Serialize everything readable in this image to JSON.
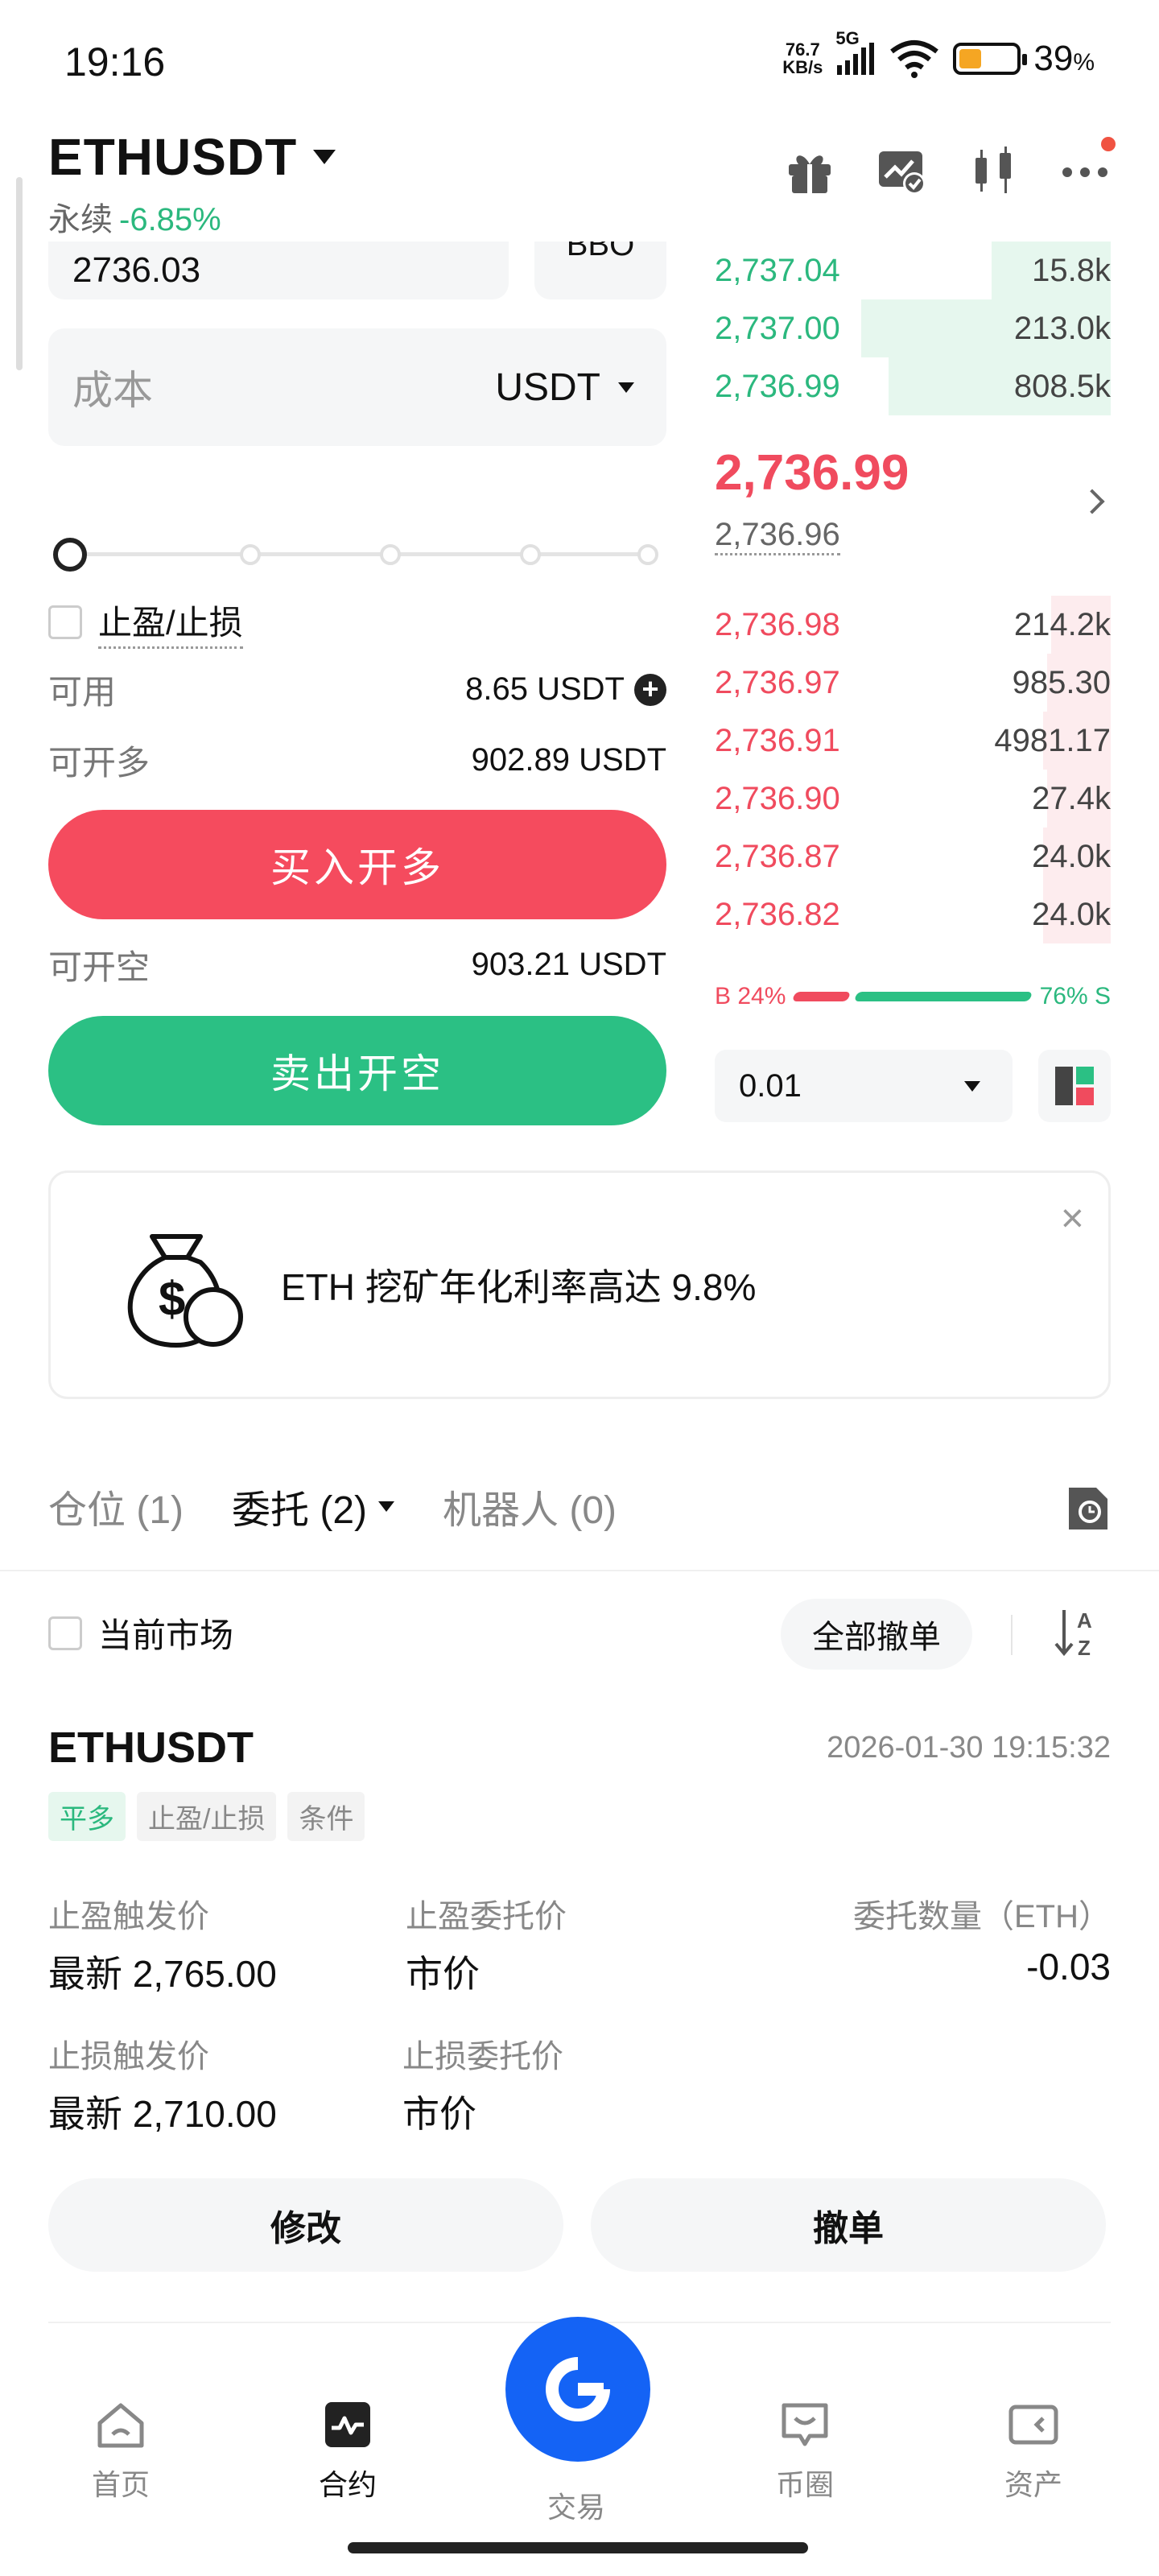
{
  "status_bar": {
    "time": "19:16",
    "net_speed_value": "76.7",
    "net_speed_unit": "KB/s",
    "network": "5G",
    "battery": "39",
    "battery_unit": "%"
  },
  "header": {
    "symbol": "ETHUSDT",
    "contract_type": "永续",
    "change": "-6.85%",
    "icons": [
      "gift-icon",
      "chart-check-icon",
      "candlestick-icon",
      "more-icon"
    ]
  },
  "order_form": {
    "price_value": "2736.03",
    "bbo_label": "BBO",
    "cost_placeholder": "成本",
    "cost_unit": "USDT",
    "slider_level": 0,
    "tpsl_label": "止盈/止损",
    "available_label": "可用",
    "available_value": "8.65 USDT",
    "can_open_long_label": "可开多",
    "can_open_long_value": "902.89 USDT",
    "buy_button": "买入开多",
    "can_open_short_label": "可开空",
    "can_open_short_value": "903.21 USDT",
    "sell_button": "卖出开空"
  },
  "order_book": {
    "asks": [
      {
        "price": "2,737.04",
        "qty": "15.8k",
        "depth": 0.3
      },
      {
        "price": "2,737.00",
        "qty": "213.0k",
        "depth": 0.63
      },
      {
        "price": "2,736.99",
        "qty": "808.5k",
        "depth": 0.56
      }
    ],
    "last_price": "2,736.99",
    "mark_price": "2,736.96",
    "bids": [
      {
        "price": "2,736.98",
        "qty": "214.2k",
        "depth": 0.15
      },
      {
        "price": "2,736.97",
        "qty": "985.30",
        "depth": 0.16
      },
      {
        "price": "2,736.91",
        "qty": "4981.17",
        "depth": 0.17
      },
      {
        "price": "2,736.90",
        "qty": "27.4k",
        "depth": 0.16
      },
      {
        "price": "2,736.87",
        "qty": "24.0k",
        "depth": 0.17
      },
      {
        "price": "2,736.82",
        "qty": "24.0k",
        "depth": 0.17
      }
    ],
    "buy_ratio_label": "B 24%",
    "sell_ratio_label": "76% S",
    "buy_ratio": 24,
    "sell_ratio": 76,
    "precision": "0.01"
  },
  "promo": {
    "text": "ETH 挖矿年化利率高达 9.8%",
    "close": "×"
  },
  "tabs": {
    "positions": "仓位 (1)",
    "orders": "委托 (2)",
    "bots": "机器人 (0)"
  },
  "filter": {
    "current_market": "当前市场",
    "cancel_all": "全部撤单"
  },
  "order": {
    "symbol": "ETHUSDT",
    "time": "2026-01-30 19:15:32",
    "tags": [
      "平多",
      "止盈/止损",
      "条件"
    ],
    "tp_trigger_label": "止盈触发价",
    "tp_trigger_value": "最新 2,765.00",
    "tp_order_label": "止盈委托价",
    "tp_order_value": "市价",
    "qty_label": "委托数量（ETH）",
    "qty_value": "-0.03",
    "sl_trigger_label": "止损触发价",
    "sl_trigger_value": "最新 2,710.00",
    "sl_order_label": "止损委托价",
    "sl_order_value": "市价",
    "modify_button": "修改",
    "cancel_button": "撤单"
  },
  "bottom_nav": {
    "items": [
      "首页",
      "合约",
      "交易",
      "币圈",
      "资产"
    ]
  },
  "colors": {
    "up_green": "#2bb87e",
    "down_red": "#f04b5e",
    "brand_blue": "#1463f5"
  }
}
